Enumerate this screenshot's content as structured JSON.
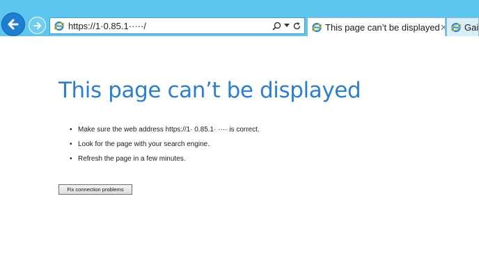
{
  "browser": {
    "address_bar": {
      "url": "https://1·0.85.1·····/",
      "icons": [
        "ie-logo-icon",
        "search-icon",
        "dropdown-arrow-icon",
        "refresh-icon"
      ]
    },
    "nav": {
      "back_icon": "back-arrow-icon",
      "forward_icon": "forward-arrow-icon"
    },
    "tabs": [
      {
        "label": "This page can’t be displayed",
        "active": true,
        "close_icon": "close-icon"
      },
      {
        "label": "Gaia",
        "active": false
      }
    ],
    "colors": {
      "chrome_bg": "#5cc6ee",
      "back_button": "#1e7fd0",
      "heading": "#2a7fd4"
    }
  },
  "page": {
    "heading": "This page can’t be displayed",
    "suggestions": [
      "Make sure the web address https://1· 0.85.1· ···· is correct.",
      "Look for the page with your search engine.",
      "Refresh the page in a few minutes."
    ],
    "fix_button_label": "Fix connection problems"
  }
}
